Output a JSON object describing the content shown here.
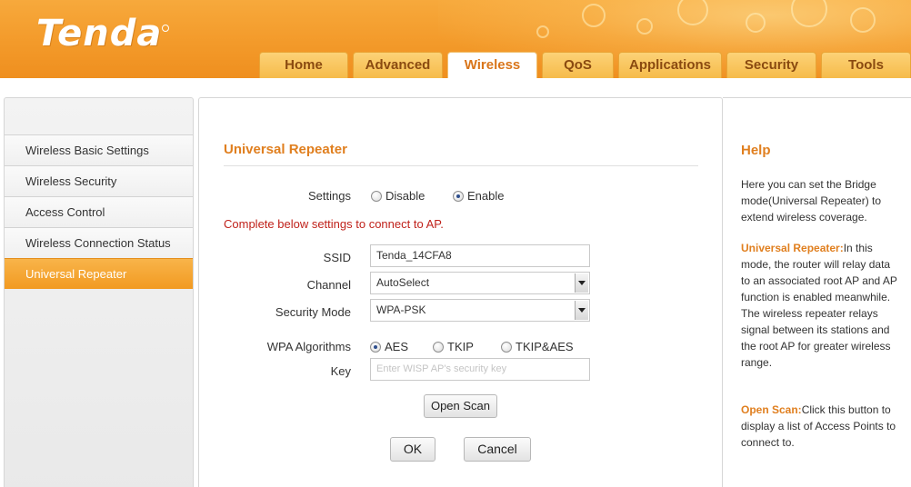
{
  "brand": {
    "logo_text": "Tenda"
  },
  "nav": {
    "tabs": [
      {
        "label": "Home"
      },
      {
        "label": "Advanced"
      },
      {
        "label": "Wireless"
      },
      {
        "label": "QoS"
      },
      {
        "label": "Applications"
      },
      {
        "label": "Security"
      },
      {
        "label": "Tools"
      }
    ],
    "active_tab": "Wireless"
  },
  "sidebar": {
    "items": [
      {
        "label": "Wireless Basic Settings"
      },
      {
        "label": "Wireless Security"
      },
      {
        "label": "Access Control"
      },
      {
        "label": "Wireless Connection Status"
      },
      {
        "label": "Universal Repeater"
      }
    ],
    "active_item": "Universal Repeater"
  },
  "main": {
    "title": "Universal Repeater",
    "settings": {
      "label": "Settings",
      "options": [
        "Disable",
        "Enable"
      ],
      "selected": "Enable"
    },
    "notice": "Complete below settings to connect to AP.",
    "ssid": {
      "label": "SSID",
      "value": "Tenda_14CFA8"
    },
    "channel": {
      "label": "Channel",
      "value": "AutoSelect"
    },
    "security_mode": {
      "label": "Security Mode",
      "value": "WPA-PSK"
    },
    "wpa_algorithms": {
      "label": "WPA Algorithms",
      "options": [
        "AES",
        "TKIP",
        "TKIP&AES"
      ],
      "selected": "AES"
    },
    "key": {
      "label": "Key",
      "value": "",
      "placeholder": "Enter WISP AP's security key"
    },
    "buttons": {
      "open_scan": "Open Scan",
      "ok": "OK",
      "cancel": "Cancel"
    }
  },
  "help": {
    "title": "Help",
    "intro": "Here you can set the Bridge mode(Universal Repeater) to extend wireless coverage.",
    "universal_repeater_term": "Universal Repeater:",
    "universal_repeater_text": "In this mode, the router will relay data to an associated root AP and AP function is enabled meanwhile. The wireless repeater relays signal between its stations and the root AP for greater wireless range.",
    "open_scan_term": "Open Scan:",
    "open_scan_text": "Click this button to display a list of Access Points to connect to."
  },
  "colors": {
    "brand_orange": "#f39a2a",
    "accent_orange": "#e07f1f",
    "notice_red": "#c0221b"
  }
}
